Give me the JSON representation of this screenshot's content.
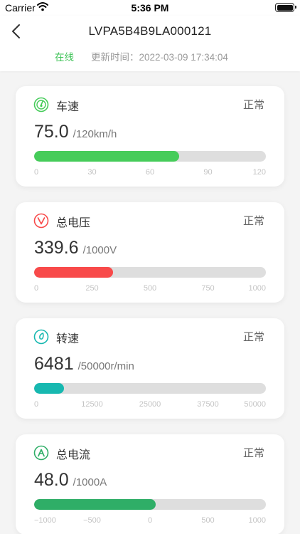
{
  "status_bar": {
    "carrier": "Carrier",
    "time": "5:36 PM"
  },
  "header": {
    "title": "LVPA5B4B9LA000121",
    "online_label": "在线",
    "update_label": "更新时间：",
    "update_time": "2022-03-09 17:34:04"
  },
  "cards": [
    {
      "name": "车速",
      "status": "正常",
      "value": "75.0",
      "unit": "/120km/h",
      "fraction": 0.625,
      "color": "#46cc5a",
      "icon": "speedometer-icon",
      "ticks": [
        "0",
        "30",
        "60",
        "90",
        "120"
      ]
    },
    {
      "name": "总电压",
      "status": "正常",
      "value": "339.6",
      "unit": "/1000V",
      "fraction": 0.34,
      "color": "#f84a4a",
      "icon": "voltage-icon",
      "ticks": [
        "0",
        "250",
        "500",
        "750",
        "1000"
      ]
    },
    {
      "name": "转速",
      "status": "正常",
      "value": "6481",
      "unit": "/50000r/min",
      "fraction": 0.13,
      "color": "#17b8b0",
      "icon": "rotation-speed-icon",
      "ticks": [
        "0",
        "12500",
        "25000",
        "37500",
        "50000"
      ]
    },
    {
      "name": "总电流",
      "status": "正常",
      "value": "48.0",
      "unit": "/1000A",
      "fraction": 0.524,
      "color": "#2fae67",
      "icon": "current-icon",
      "ticks": [
        "−1000",
        "−500",
        "0",
        "500",
        "1000"
      ]
    }
  ]
}
